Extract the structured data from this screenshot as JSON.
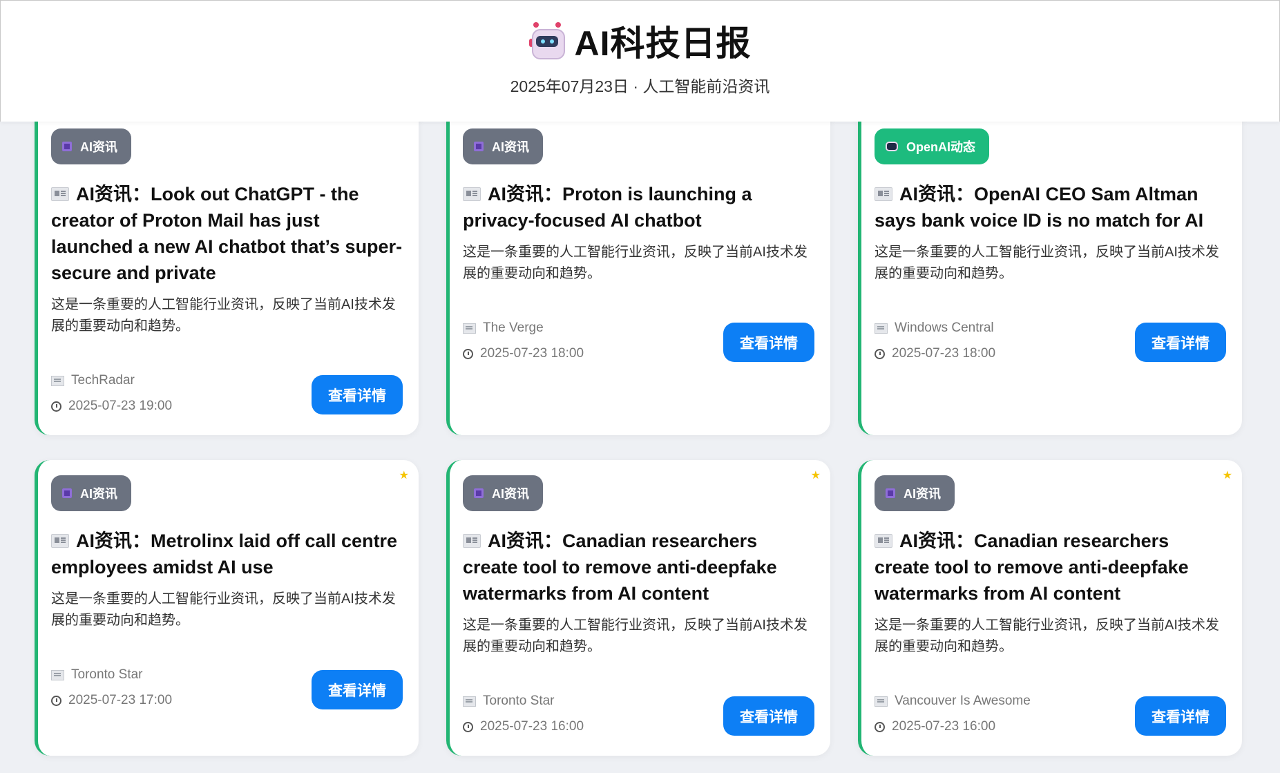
{
  "header": {
    "title": "AI科技日报",
    "subtitle": "2025年07月23日 · 人工智能前沿资讯"
  },
  "colors": {
    "accent_green": "#22b573",
    "button_blue": "#0d7ff5",
    "badge_gray": "#6b7280",
    "badge_openai": "#1dbb7e",
    "star": "#f5c400"
  },
  "cards": [
    {
      "badge": "AI资讯",
      "title": "AI资讯：Look out ChatGPT - the creator of Proton Mail has just launched a new AI chatbot that’s super-secure and private",
      "description": "这是一条重要的人工智能行业资讯，反映了当前AI技术发展的重要动向和趋势。",
      "source": "TechRadar",
      "time": "2025-07-23 19:00",
      "button": "查看详情",
      "star": "★"
    },
    {
      "badge": "AI资讯",
      "title": "AI资讯：Proton is launching a privacy-focused AI chatbot",
      "description": "这是一条重要的人工智能行业资讯，反映了当前AI技术发展的重要动向和趋势。",
      "source": "The Verge",
      "time": "2025-07-23 18:00",
      "button": "查看详情",
      "star": "★"
    },
    {
      "badge": "OpenAI动态",
      "title": "AI资讯：OpenAI CEO Sam Altman says bank voice ID is no match for AI",
      "description": "这是一条重要的人工智能行业资讯，反映了当前AI技术发展的重要动向和趋势。",
      "source": "Windows Central",
      "time": "2025-07-23 18:00",
      "button": "查看详情",
      "star": "★"
    },
    {
      "badge": "AI资讯",
      "title": "AI资讯：Metrolinx laid off call centre employees amidst AI use",
      "description": "这是一条重要的人工智能行业资讯，反映了当前AI技术发展的重要动向和趋势。",
      "source": "Toronto Star",
      "time": "2025-07-23 17:00",
      "button": "查看详情",
      "star": "★"
    },
    {
      "badge": "AI资讯",
      "title": "AI资讯：Canadian researchers create tool to remove anti-deepfake watermarks from AI content",
      "description": "这是一条重要的人工智能行业资讯，反映了当前AI技术发展的重要动向和趋势。",
      "source": "Toronto Star",
      "time": "2025-07-23 16:00",
      "button": "查看详情",
      "star": "★"
    },
    {
      "badge": "AI资讯",
      "title": "AI资讯：Canadian researchers create tool to remove anti-deepfake watermarks from AI content",
      "description": "这是一条重要的人工智能行业资讯，反映了当前AI技术发展的重要动向和趋势。",
      "source": "Vancouver Is Awesome",
      "time": "2025-07-23 16:00",
      "button": "查看详情",
      "star": "★"
    }
  ]
}
